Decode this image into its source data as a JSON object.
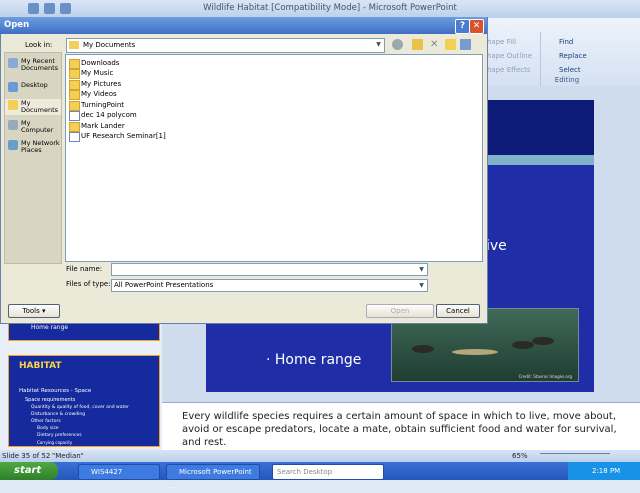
{
  "ppt": {
    "title": "Wildlife Habitat [Compatibility Mode] - Microsoft PowerPoint",
    "ribbon_shapes": [
      "hape Fill",
      "hape Outline",
      "hape Effects"
    ],
    "editing_items": [
      "Find",
      "Replace",
      "Select"
    ],
    "editing_group_label": "Editing",
    "slide_text_ive": "ive",
    "slide_bullet": "Home range",
    "photo_credit": "Credit: Stavros Images.org",
    "notes": "Every wildlife species requires a certain amount of space in which to live, move about, avoid or escape predators, locate a mate, obtain sufficient food and water for survival, and rest.",
    "thumb_prev_text": "Home range",
    "thumb_habitat": {
      "title": "HABITAT",
      "lines": [
        "Habitat Resources - Space",
        "Space requirements",
        "Quantity & quality of food, cover and water",
        "Disturbance & crowding",
        "Other factors",
        "Body size",
        "Dietary preferences",
        "Carrying capacity"
      ]
    },
    "status": {
      "slide": "Slide 35 of 52",
      "theme": "\"Median\"",
      "zoom": "65%"
    }
  },
  "taskbar": {
    "start": "start",
    "items": [
      "WIS4427",
      "Microsoft PowerPoint ...."
    ],
    "search_placeholder": "Search Desktop",
    "time": "2:18 PM"
  },
  "dialog": {
    "title": "Open",
    "help": "?",
    "close": "✕",
    "look_in_label": "Look in:",
    "look_in_value": "My Documents",
    "places": [
      "My Recent Documents",
      "Desktop",
      "My Documents",
      "My Computer",
      "My Network Places"
    ],
    "files": [
      {
        "name": "Downloads",
        "kind": "folder"
      },
      {
        "name": "My Music",
        "kind": "folder"
      },
      {
        "name": "My Pictures",
        "kind": "folder"
      },
      {
        "name": "My Videos",
        "kind": "folder"
      },
      {
        "name": "TurningPoint",
        "kind": "folder"
      },
      {
        "name": "dec 14 polycom",
        "kind": "doc"
      },
      {
        "name": "Mark Lander",
        "kind": "folder"
      },
      {
        "name": "UF Research Seminar[1]",
        "kind": "doc"
      }
    ],
    "file_name_label": "File name:",
    "file_name_value": "",
    "file_type_label": "Files of type:",
    "file_type_value": "All PowerPoint Presentations",
    "tools": "Tools",
    "open": "Open",
    "cancel": "Cancel"
  }
}
